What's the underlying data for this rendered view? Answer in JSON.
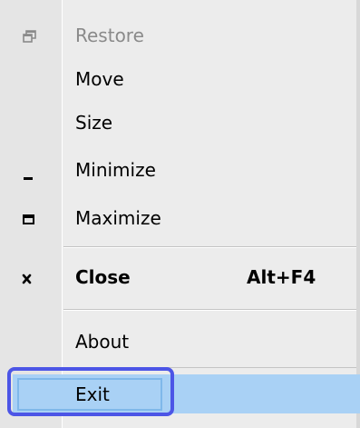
{
  "menu": {
    "items": [
      {
        "label": "Restore",
        "icon": "restore-icon",
        "enabled": false,
        "shortcut": ""
      },
      {
        "label": "Move",
        "icon": "",
        "enabled": true,
        "shortcut": ""
      },
      {
        "label": "Size",
        "icon": "",
        "enabled": true,
        "shortcut": ""
      },
      {
        "label": "Minimize",
        "icon": "minimize-icon",
        "enabled": true,
        "shortcut": ""
      },
      {
        "label": "Maximize",
        "icon": "maximize-icon",
        "enabled": true,
        "shortcut": ""
      },
      {
        "label": "Close",
        "icon": "close-icon",
        "enabled": true,
        "shortcut": "Alt+F4",
        "bold": true
      },
      {
        "label": "About",
        "icon": "",
        "enabled": true,
        "shortcut": ""
      },
      {
        "label": "Exit",
        "icon": "",
        "enabled": true,
        "shortcut": "",
        "highlighted": true
      }
    ],
    "colors": {
      "highlight": "#a9d1f5",
      "focus_ring": "#4c55e6",
      "disabled_text": "#8a8a8a"
    }
  }
}
